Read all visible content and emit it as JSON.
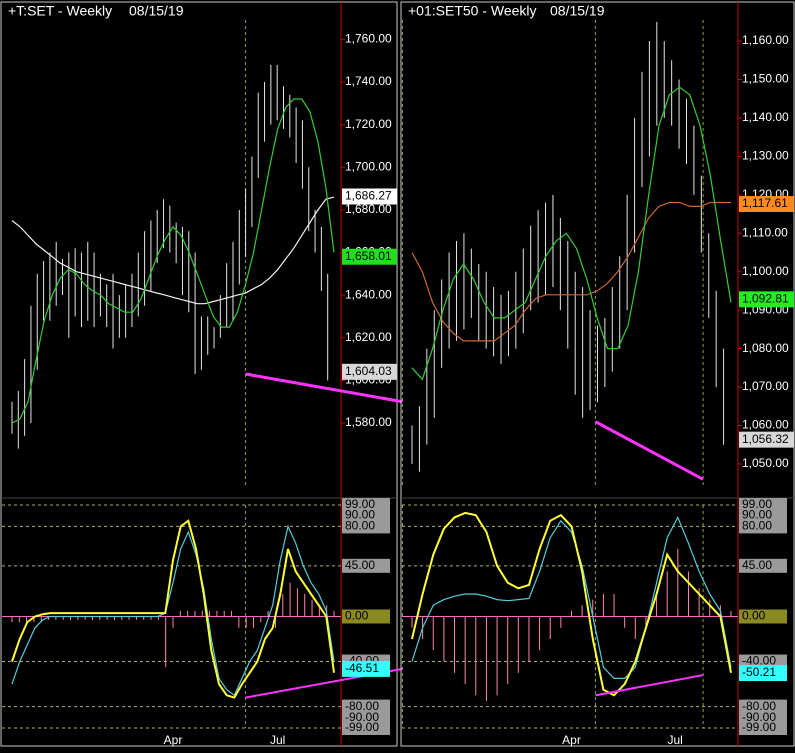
{
  "colors": {
    "background": "#000000",
    "frame": "#c8c8c8",
    "axis_red": "#cc0000",
    "price_bar": "#e6e6e6",
    "fast_ma": "#33cc33",
    "slow_ma_left": "#f2f2f2",
    "slow_ma_right": "#cc6633",
    "divergence": "#ff33ff",
    "osc_yellow": "#ffff33",
    "osc_cyan": "#55ccdd",
    "histogram": "#ff88aa",
    "grid_dash": "#b0b060",
    "vline_dash": "#88aa44"
  },
  "chart_data": [
    {
      "type": "line",
      "panel": "left",
      "title": "+T:SET - Weekly",
      "date": "08/15/19",
      "x_labels": [
        {
          "text": "Apr",
          "week": 20
        },
        {
          "text": "Jul",
          "week": 33
        }
      ],
      "weeks": 40,
      "price": {
        "ylim": [
          1550,
          1770
        ],
        "ticks": [
          {
            "v": 1760,
            "t": "1,760.00"
          },
          {
            "v": 1740,
            "t": "1,740.00"
          },
          {
            "v": 1720,
            "t": "1,720.00"
          },
          {
            "v": 1700,
            "t": "1,700.00"
          },
          {
            "v": 1680,
            "t": "1,680.00"
          },
          {
            "v": 1660,
            "t": "1,660.00"
          },
          {
            "v": 1640,
            "t": "1,640.00"
          },
          {
            "v": 1620,
            "t": "1,620.00"
          },
          {
            "v": 1600,
            "t": "1,600.00"
          },
          {
            "v": 1580,
            "t": "1,580.00"
          }
        ],
        "price_labels": [
          {
            "v": 1686.27,
            "t": "1,686.27",
            "bg": "#ffffff",
            "fg": "#000000"
          },
          {
            "v": 1658.01,
            "t": "1,658.01",
            "bg": "#22dd22",
            "fg": "#000000"
          },
          {
            "v": 1604.03,
            "t": "1,604.03",
            "bg": "#d8d8d8",
            "fg": "#000000"
          }
        ],
        "bars": [
          [
            1590,
            1575
          ],
          [
            1595,
            1568
          ],
          [
            1610,
            1574
          ],
          [
            1635,
            1580
          ],
          [
            1650,
            1605
          ],
          [
            1656,
            1628
          ],
          [
            1660,
            1628
          ],
          [
            1665,
            1635
          ],
          [
            1657,
            1640
          ],
          [
            1660,
            1620
          ],
          [
            1662,
            1630
          ],
          [
            1660,
            1625
          ],
          [
            1665,
            1628
          ],
          [
            1660,
            1625
          ],
          [
            1650,
            1630
          ],
          [
            1645,
            1625
          ],
          [
            1650,
            1615
          ],
          [
            1640,
            1620
          ],
          [
            1645,
            1620
          ],
          [
            1650,
            1625
          ],
          [
            1660,
            1630
          ],
          [
            1670,
            1635
          ],
          [
            1675,
            1642
          ],
          [
            1680,
            1655
          ],
          [
            1685,
            1662
          ],
          [
            1682,
            1660
          ],
          [
            1674,
            1655
          ],
          [
            1672,
            1640
          ],
          [
            1670,
            1632
          ],
          [
            1660,
            1603
          ],
          [
            1630,
            1605
          ],
          [
            1630,
            1612
          ],
          [
            1625,
            1615
          ],
          [
            1640,
            1620
          ],
          [
            1655,
            1625
          ],
          [
            1665,
            1628
          ],
          [
            1680,
            1645
          ],
          [
            1690,
            1658
          ],
          [
            1705,
            1672
          ],
          [
            1735,
            1695
          ],
          [
            1740,
            1712
          ],
          [
            1748,
            1720
          ],
          [
            1748,
            1722
          ],
          [
            1738,
            1718
          ],
          [
            1734,
            1714
          ],
          [
            1728,
            1702
          ],
          [
            1722,
            1690
          ],
          [
            1700,
            1670
          ],
          [
            1680,
            1660
          ],
          [
            1672,
            1642
          ],
          [
            1650,
            1600
          ]
        ],
        "fast_ma": [
          1580,
          1582,
          1590,
          1610,
          1628,
          1640,
          1648,
          1652,
          1650,
          1645,
          1642,
          1640,
          1636,
          1634,
          1632,
          1632,
          1638,
          1648,
          1658,
          1666,
          1672,
          1668,
          1660,
          1650,
          1640,
          1630,
          1625,
          1625,
          1632,
          1645,
          1660,
          1680,
          1700,
          1718,
          1728,
          1732,
          1732,
          1726,
          1712,
          1690,
          1660
        ],
        "slow_ma": [
          1675,
          1672,
          1668,
          1664,
          1661,
          1658,
          1655,
          1653,
          1651,
          1650,
          1649,
          1648,
          1647,
          1646,
          1645,
          1644,
          1643,
          1642,
          1641,
          1640,
          1639,
          1638,
          1637,
          1636,
          1636,
          1637,
          1638,
          1639,
          1640,
          1641,
          1643,
          1645,
          1648,
          1652,
          1657,
          1662,
          1668,
          1674,
          1680,
          1685,
          1686
        ],
        "divergence": [
          [
            29,
            1603
          ],
          [
            48.5,
            1590
          ]
        ],
        "vlines": [
          29,
          48.5
        ]
      },
      "oscillator": {
        "ylim": [
          -99,
          99
        ],
        "ticks": [
          {
            "v": 99,
            "t": "99.00",
            "dashed": true
          },
          {
            "v": 90,
            "t": "90.00",
            "dashed": false
          },
          {
            "v": 80,
            "t": "80.00",
            "dashed": true
          },
          {
            "v": 45,
            "t": "45.00",
            "dashed": true
          },
          {
            "v": 0,
            "t": "0.00",
            "dashed": false
          },
          {
            "v": -40,
            "t": "-40.00",
            "dashed": true
          },
          {
            "v": -46.51,
            "t": "-46.51",
            "dashed": false
          },
          {
            "v": -80,
            "t": "-80.00",
            "dashed": true
          },
          {
            "v": -90,
            "t": "-90.00",
            "dashed": false
          },
          {
            "v": -99,
            "t": "-99.00",
            "dashed": true
          }
        ],
        "value_label": {
          "v": -46.51,
          "t": "-46.51",
          "bg": "#33ffff",
          "fg": "#000000"
        },
        "yellow": [
          -40,
          -20,
          -5,
          0,
          2,
          3,
          3,
          3,
          3,
          3,
          3,
          3,
          3,
          3,
          3,
          3,
          3,
          3,
          3,
          3,
          3,
          50,
          80,
          85,
          60,
          20,
          -30,
          -60,
          -70,
          -72,
          -60,
          -50,
          -40,
          -20,
          -10,
          20,
          60,
          40,
          30,
          20,
          10,
          0,
          -50
        ],
        "cyan": [
          -60,
          -40,
          -25,
          -10,
          -3,
          0,
          0,
          0,
          0,
          0,
          0,
          0,
          0,
          0,
          0,
          0,
          0,
          0,
          0,
          0,
          3,
          30,
          60,
          75,
          55,
          25,
          -20,
          -55,
          -65,
          -70,
          -55,
          -40,
          -30,
          -10,
          10,
          50,
          80,
          65,
          45,
          30,
          20,
          5,
          -40
        ],
        "hist": [
          -5,
          -5,
          -5,
          -5,
          -5,
          -3,
          -3,
          -3,
          -3,
          -3,
          -3,
          -3,
          -3,
          -3,
          -3,
          -3,
          -3,
          -3,
          -3,
          -3,
          -3,
          -45,
          -10,
          5,
          5,
          5,
          5,
          5,
          5,
          5,
          5,
          -10,
          -10,
          -10,
          -5,
          5,
          -10,
          20,
          30,
          25,
          20,
          15,
          10,
          10,
          5
        ],
        "divergence": [
          [
            29,
            -72
          ],
          [
            48.5,
            -46.51
          ]
        ]
      }
    },
    {
      "type": "line",
      "panel": "right",
      "title": "+01:SET50 - Weekly",
      "date": "08/15/19",
      "x_labels": [
        {
          "text": "Apr",
          "week": 20
        },
        {
          "text": "Jul",
          "week": 33
        }
      ],
      "weeks": 40,
      "price": {
        "ylim": [
          1044,
          1166
        ],
        "ticks": [
          {
            "v": 1160,
            "t": "1,160.00"
          },
          {
            "v": 1150,
            "t": "1,150.00"
          },
          {
            "v": 1140,
            "t": "1,140.00"
          },
          {
            "v": 1130,
            "t": "1,130.00"
          },
          {
            "v": 1120,
            "t": "1,120.00"
          },
          {
            "v": 1110,
            "t": "1,110.00"
          },
          {
            "v": 1100,
            "t": "1,100.00"
          },
          {
            "v": 1090,
            "t": "1,090.00"
          },
          {
            "v": 1080,
            "t": "1,080.00"
          },
          {
            "v": 1070,
            "t": "1,070.00"
          },
          {
            "v": 1060,
            "t": "1,060.00"
          },
          {
            "v": 1050,
            "t": "1,050.00"
          }
        ],
        "price_labels": [
          {
            "v": 1117.61,
            "t": "1,117.61",
            "bg": "#ff8a1e",
            "fg": "#000000"
          },
          {
            "v": 1092.81,
            "t": "1,092.81",
            "bg": "#22ee22",
            "fg": "#000000"
          },
          {
            "v": 1056.32,
            "t": "1,056.32",
            "bg": "#d8d8d8",
            "fg": "#000000"
          }
        ],
        "bars": [
          [
            1060,
            1050
          ],
          [
            1065,
            1048
          ],
          [
            1080,
            1055
          ],
          [
            1090,
            1062
          ],
          [
            1098,
            1075
          ],
          [
            1105,
            1080
          ],
          [
            1108,
            1082
          ],
          [
            1110,
            1085
          ],
          [
            1106,
            1088
          ],
          [
            1102,
            1082
          ],
          [
            1100,
            1080
          ],
          [
            1096,
            1078
          ],
          [
            1094,
            1076
          ],
          [
            1095,
            1078
          ],
          [
            1100,
            1080
          ],
          [
            1106,
            1084
          ],
          [
            1112,
            1090
          ],
          [
            1116,
            1092
          ],
          [
            1118,
            1094
          ],
          [
            1120,
            1096
          ],
          [
            1114,
            1090
          ],
          [
            1108,
            1080
          ],
          [
            1100,
            1068
          ],
          [
            1096,
            1062
          ],
          [
            1090,
            1064
          ],
          [
            1086,
            1066
          ],
          [
            1088,
            1070
          ],
          [
            1096,
            1074
          ],
          [
            1104,
            1080
          ],
          [
            1120,
            1090
          ],
          [
            1140,
            1105
          ],
          [
            1152,
            1122
          ],
          [
            1160,
            1130
          ],
          [
            1165,
            1138
          ],
          [
            1160,
            1140
          ],
          [
            1155,
            1138
          ],
          [
            1150,
            1132
          ],
          [
            1145,
            1128
          ],
          [
            1138,
            1120
          ],
          [
            1125,
            1105
          ],
          [
            1110,
            1088
          ],
          [
            1095,
            1070
          ],
          [
            1080,
            1055
          ]
        ],
        "fast_ma": [
          1075,
          1072,
          1080,
          1090,
          1098,
          1102,
          1098,
          1092,
          1088,
          1088,
          1090,
          1092,
          1098,
          1104,
          1108,
          1110,
          1106,
          1098,
          1088,
          1080,
          1080,
          1086,
          1100,
          1120,
          1138,
          1146,
          1148,
          1146,
          1138,
          1125,
          1108,
          1092
        ],
        "slow_ma": [
          1105,
          1100,
          1092,
          1087,
          1084,
          1082,
          1082,
          1082,
          1082,
          1084,
          1086,
          1090,
          1093,
          1094,
          1094,
          1094,
          1094,
          1094,
          1095,
          1097,
          1100,
          1104,
          1109,
          1114,
          1117,
          1118,
          1118,
          1117,
          1117,
          1118,
          1118,
          1118
        ],
        "divergence": [
          [
            23,
            1061
          ],
          [
            36.5,
            1046
          ]
        ],
        "vlines": [
          23,
          36.5
        ]
      },
      "oscillator": {
        "ylim": [
          -99,
          99
        ],
        "ticks": [
          {
            "v": 99,
            "t": "99.00",
            "dashed": true
          },
          {
            "v": 90,
            "t": "90.00",
            "dashed": false
          },
          {
            "v": 80,
            "t": "80.00",
            "dashed": true
          },
          {
            "v": 45,
            "t": "45.00",
            "dashed": true
          },
          {
            "v": 0,
            "t": "0.00",
            "dashed": false
          },
          {
            "v": -40,
            "t": "-40.00",
            "dashed": true
          },
          {
            "v": -50.21,
            "t": "-50.21",
            "dashed": false
          },
          {
            "v": -80,
            "t": "-80.00",
            "dashed": true
          },
          {
            "v": -90,
            "t": "-90.00",
            "dashed": false
          },
          {
            "v": -99,
            "t": "-99.00",
            "dashed": true
          }
        ],
        "value_label": {
          "v": -50.21,
          "t": "-50.21",
          "bg": "#33ffff",
          "fg": "#000000"
        },
        "yellow": [
          -20,
          20,
          55,
          78,
          88,
          92,
          90,
          75,
          45,
          30,
          25,
          28,
          60,
          85,
          90,
          80,
          40,
          -20,
          -65,
          -70,
          -60,
          -40,
          -10,
          20,
          55,
          40,
          30,
          20,
          10,
          0,
          -50
        ],
        "cyan": [
          -40,
          -10,
          10,
          15,
          18,
          20,
          20,
          18,
          15,
          14,
          15,
          16,
          40,
          70,
          85,
          75,
          45,
          0,
          -45,
          -55,
          -55,
          -45,
          -10,
          30,
          70,
          88,
          65,
          40,
          20,
          5,
          -45
        ],
        "hist": [
          -10,
          -20,
          -30,
          -40,
          -50,
          -60,
          -70,
          -75,
          -70,
          -60,
          -50,
          -40,
          -30,
          -20,
          -10,
          5,
          10,
          15,
          20,
          20,
          -10,
          -20,
          -10,
          20,
          40,
          60,
          40,
          25,
          15,
          10,
          5
        ],
        "divergence": [
          [
            23,
            -70
          ],
          [
            36.5,
            -52
          ]
        ]
      }
    }
  ]
}
